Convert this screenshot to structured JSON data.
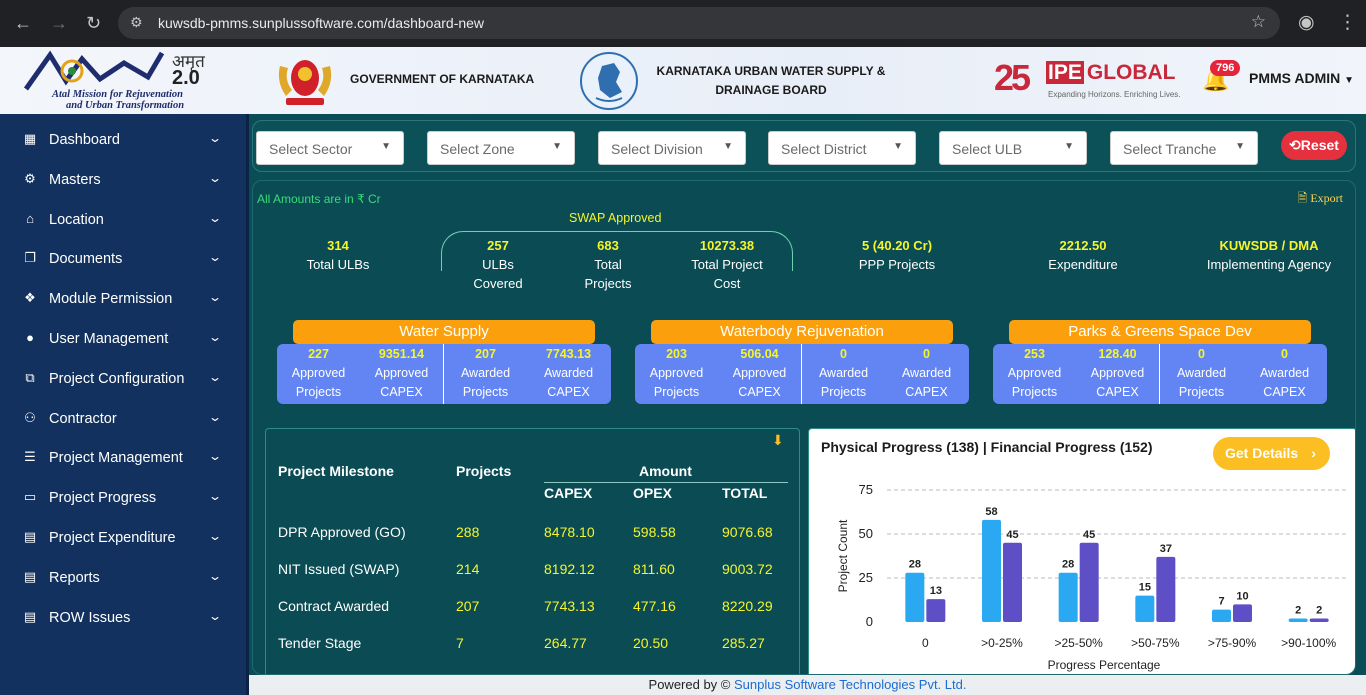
{
  "browser": {
    "url": "kuwsdb-pmms.sunplussoftware.com/dashboard-new"
  },
  "header": {
    "amrut_hindi": "अमृत",
    "amrut_version": "2.0",
    "amrut_line1": "Atal Mission for Rejuvenation",
    "amrut_line2": "and Urban Transformation",
    "gov": "GOVERNMENT OF KARNATAKA",
    "board_line1": "KARNATAKA URBAN WATER SUPPLY &",
    "board_line2": "DRAINAGE BOARD",
    "ipe_25": "25",
    "ipe_brand_a": "IPE",
    "ipe_brand_b": "GLOBAL",
    "ipe_tag": "Expanding Horizons. Enriching Lives.",
    "notifications": "796",
    "user": "PMMS ADMIN"
  },
  "sidebar": {
    "items": [
      {
        "label": "Dashboard",
        "icon": "grid-icon"
      },
      {
        "label": "Masters",
        "icon": "gear-icon"
      },
      {
        "label": "Location",
        "icon": "building-icon"
      },
      {
        "label": "Documents",
        "icon": "documents-icon"
      },
      {
        "label": "Module Permission",
        "icon": "cubes-icon"
      },
      {
        "label": "User Management",
        "icon": "user-icon"
      },
      {
        "label": "Project Configuration",
        "icon": "config-icon"
      },
      {
        "label": "Contractor",
        "icon": "users-icon"
      },
      {
        "label": "Project Management",
        "icon": "list-icon"
      },
      {
        "label": "Project Progress",
        "icon": "monitor-icon"
      },
      {
        "label": "Project Expenditure",
        "icon": "card-icon"
      },
      {
        "label": "Reports",
        "icon": "report-icon"
      },
      {
        "label": "ROW Issues",
        "icon": "card-icon"
      }
    ]
  },
  "filters": {
    "sector": "Select Sector",
    "zone": "Select Zone",
    "division": "Select Division",
    "district": "Select District",
    "ulb": "Select ULB",
    "tranche": "Select Tranche",
    "reset": "Reset"
  },
  "summary": {
    "note": "All Amounts are in ₹ Cr",
    "export": "Export",
    "swap_title": "SWAP Approved",
    "total_ulbs": {
      "value": "314",
      "label": "Total ULBs"
    },
    "ulbs_covered": {
      "value": "257",
      "label1": "ULBs",
      "label2": "Covered"
    },
    "total_projects": {
      "value": "683",
      "label1": "Total",
      "label2": "Projects"
    },
    "total_cost": {
      "value": "10273.38",
      "label1": "Total Project",
      "label2": "Cost"
    },
    "ppp": {
      "value": "5 (40.20 Cr)",
      "label": "PPP Projects"
    },
    "expenditure": {
      "value": "2212.50",
      "label": "Expenditure"
    },
    "agency": {
      "value": "KUWSDB / DMA",
      "label": "Implementing Agency"
    }
  },
  "categories": [
    {
      "title": "Water Supply",
      "ap": "227",
      "acap": "9351.14",
      "aw": "207",
      "awcap": "7743.13"
    },
    {
      "title": "Waterbody Rejuvenation",
      "ap": "203",
      "acap": "506.04",
      "aw": "0",
      "awcap": "0"
    },
    {
      "title": "Parks & Greens Space Dev",
      "ap": "253",
      "acap": "128.40",
      "aw": "0",
      "awcap": "0"
    }
  ],
  "category_labels": {
    "approved": "Approved",
    "awarded": "Awarded",
    "projects": "Projects",
    "capex": "CAPEX"
  },
  "milestone": {
    "h_milestone": "Project Milestone",
    "h_projects": "Projects",
    "h_amount": "Amount",
    "h_capex": "CAPEX",
    "h_opex": "OPEX",
    "h_total": "TOTAL",
    "rows": [
      {
        "name": "DPR Approved (GO)",
        "projects": "288",
        "capex": "8478.10",
        "opex": "598.58",
        "total": "9076.68"
      },
      {
        "name": "NIT Issued (SWAP)",
        "projects": "214",
        "capex": "8192.12",
        "opex": "811.60",
        "total": "9003.72"
      },
      {
        "name": "Contract Awarded",
        "projects": "207",
        "capex": "7743.13",
        "opex": "477.16",
        "total": "8220.29"
      },
      {
        "name": "Tender Stage",
        "projects": "7",
        "capex": "264.77",
        "opex": "20.50",
        "total": "285.27"
      }
    ]
  },
  "chart_panel": {
    "title": "Physical Progress (138) | Financial Progress (152)",
    "button": "Get Details"
  },
  "chart_data": {
    "type": "bar",
    "ylabel": "Project Count",
    "xlabel": "Progress Percentage",
    "ylim": [
      0,
      75
    ],
    "yticks": [
      0,
      25,
      50,
      75
    ],
    "categories": [
      "0",
      ">0-25%",
      ">25-50%",
      ">50-75%",
      ">75-90%",
      ">90-100%"
    ],
    "series": [
      {
        "values": [
          28,
          58,
          28,
          15,
          7,
          2
        ],
        "color": "#2aa8f2"
      },
      {
        "values": [
          13,
          45,
          45,
          37,
          10,
          2
        ],
        "color": "#5e4fc6"
      }
    ]
  },
  "footer": {
    "prefix": "Powered by ©",
    "company": "Sunplus Software Technologies Pvt. Ltd."
  }
}
